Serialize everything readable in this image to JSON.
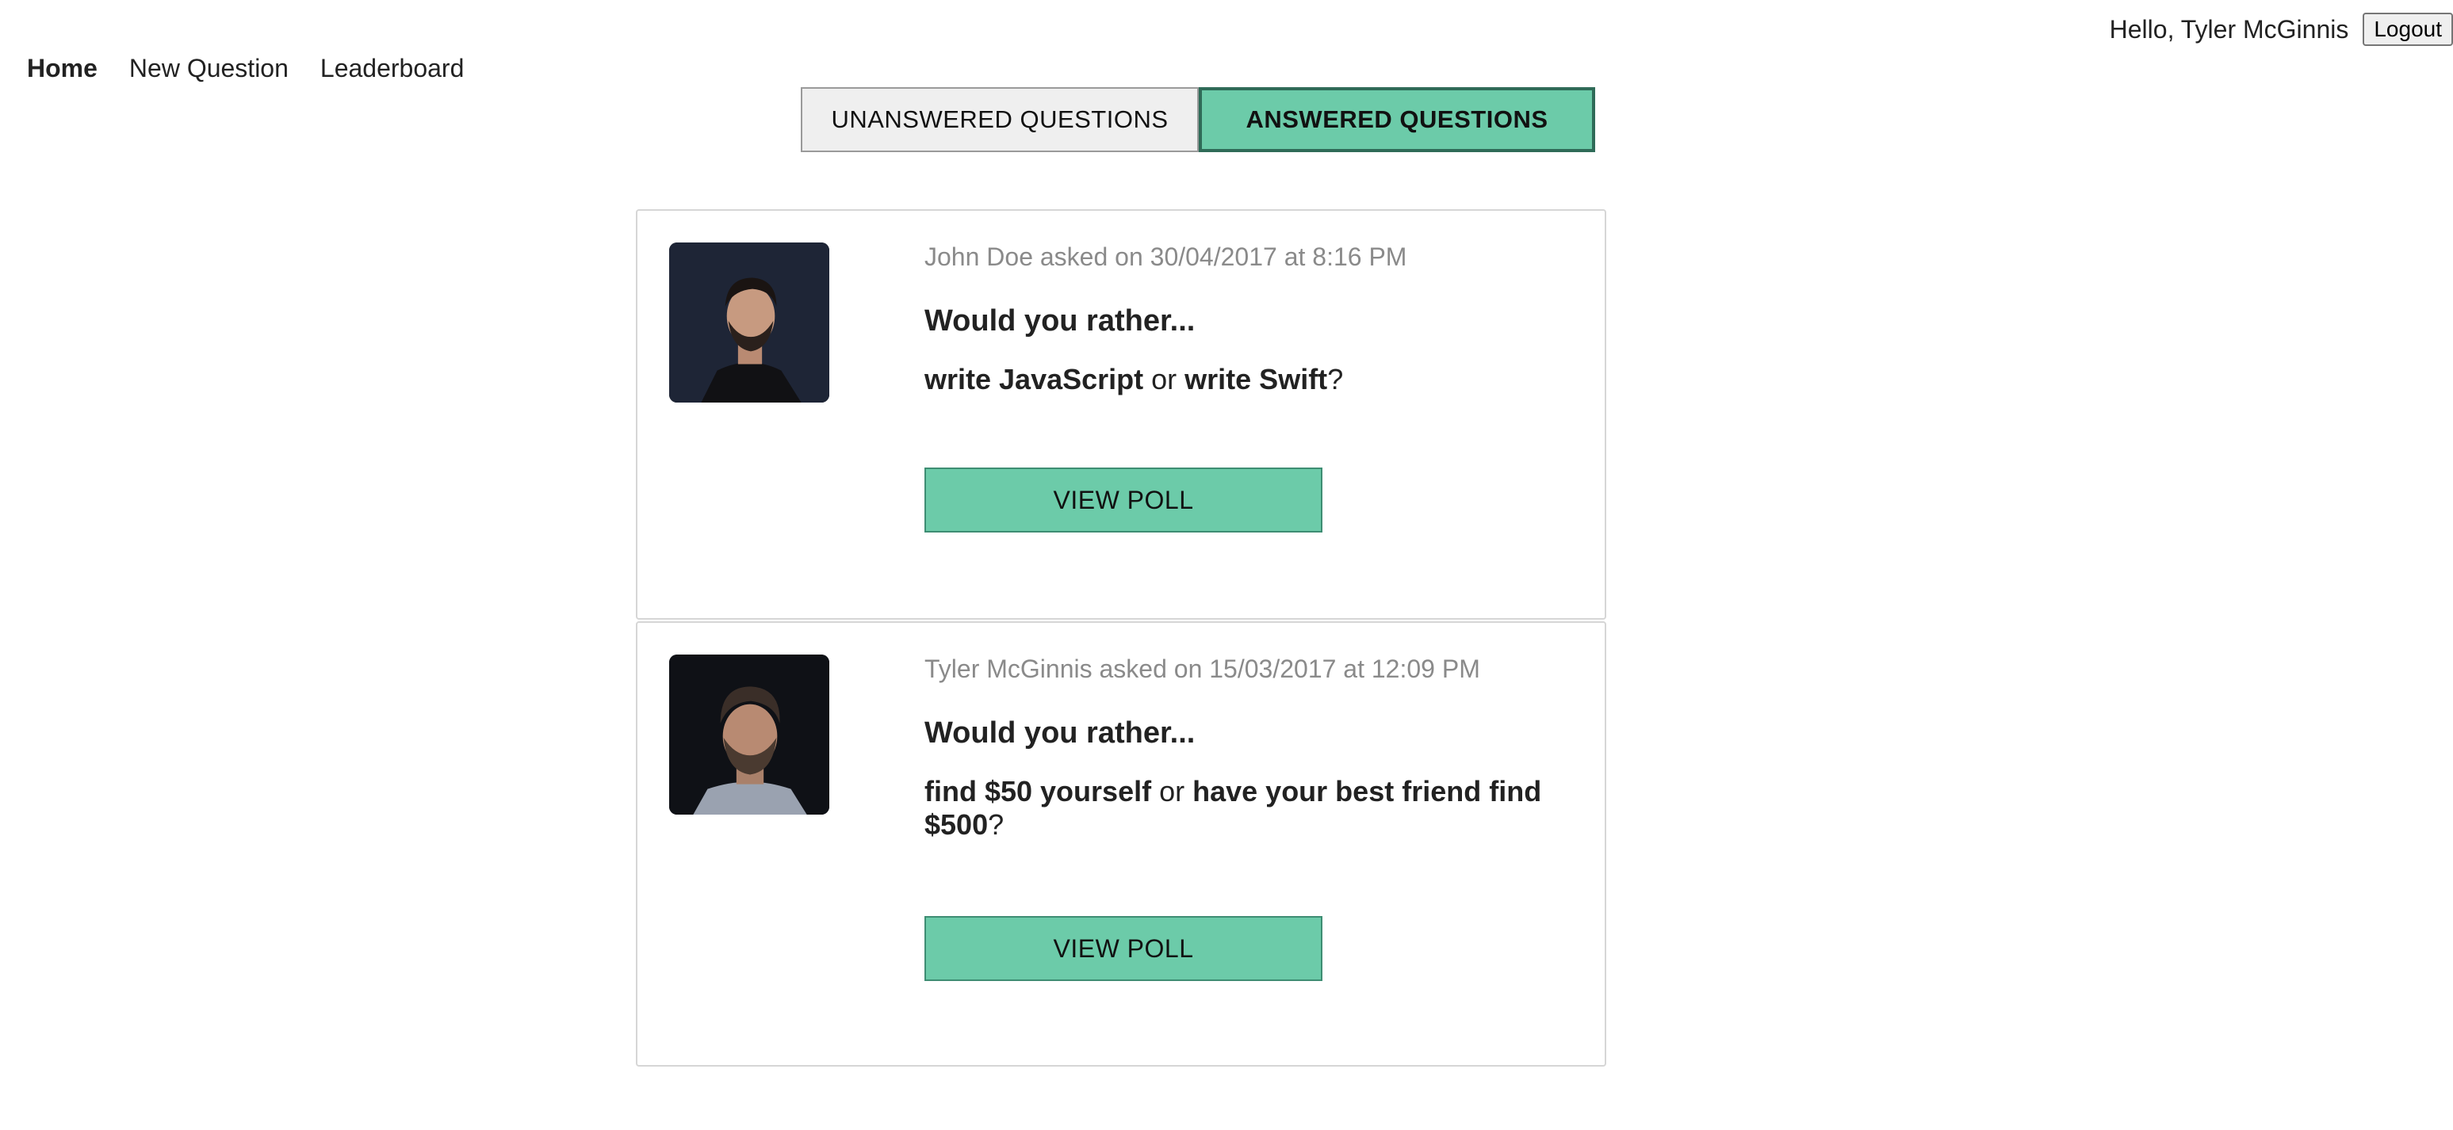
{
  "header": {
    "greeting": "Hello, Tyler McGinnis",
    "logout_label": "Logout"
  },
  "nav": {
    "items": [
      {
        "label": "Home",
        "active": true
      },
      {
        "label": "New Question",
        "active": false
      },
      {
        "label": "Leaderboard",
        "active": false
      }
    ]
  },
  "tabs": {
    "unanswered_label": "UNANSWERED QUESTIONS",
    "answered_label": "ANSWERED QUESTIONS",
    "selected": "answered"
  },
  "questions": [
    {
      "meta": "John Doe asked on 30/04/2017 at 8:16 PM",
      "prompt": "Would you rather...",
      "option_one": "write JavaScript",
      "connector": " or ",
      "option_two": "write Swift",
      "suffix": "?",
      "button_label": "VIEW POLL",
      "avatar_icon": "user-avatar-john-doe"
    },
    {
      "meta": "Tyler McGinnis asked on 15/03/2017 at 12:09 PM",
      "prompt": "Would you rather...",
      "option_one": "find $50 yourself",
      "connector": " or ",
      "option_two": "have your best friend find $500",
      "suffix": "?",
      "button_label": "VIEW POLL",
      "avatar_icon": "user-avatar-tyler-mcginnis"
    }
  ],
  "colors": {
    "accent": "#6ccba9",
    "accent_border": "#2f6b58",
    "meta_text": "#8a8a8a",
    "card_border": "#d6d6d6"
  }
}
